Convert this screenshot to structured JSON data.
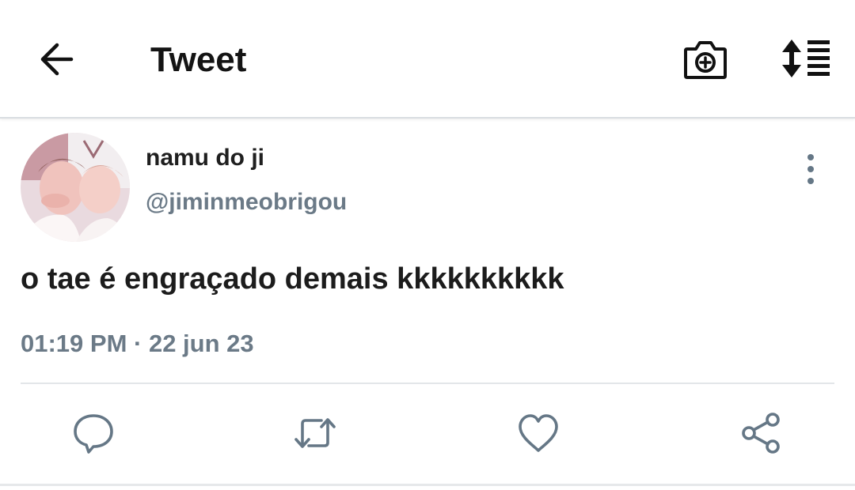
{
  "header": {
    "title": "Tweet",
    "icons": {
      "back": "arrow-left-icon",
      "camera": "camera-add-icon",
      "sort": "sort-lines-icon"
    }
  },
  "tweet": {
    "author": {
      "display_name": "namu do ji",
      "handle": "@jiminmeobrigou"
    },
    "text": "o tae é engraçado demais kkkkkkkkkk",
    "timestamp": "01:19 PM · 22 jun 23",
    "more_icon": "more-vertical-icon"
  },
  "actions": [
    {
      "name": "reply",
      "icon": "comment-bubble-icon"
    },
    {
      "name": "retweet",
      "icon": "retweet-icon"
    },
    {
      "name": "like",
      "icon": "heart-icon"
    },
    {
      "name": "share",
      "icon": "share-icon"
    }
  ],
  "colors": {
    "text_primary": "#1f1f1f",
    "text_secondary": "#6b7a87",
    "divider": "#e3e6e9",
    "icon": "#657786"
  }
}
